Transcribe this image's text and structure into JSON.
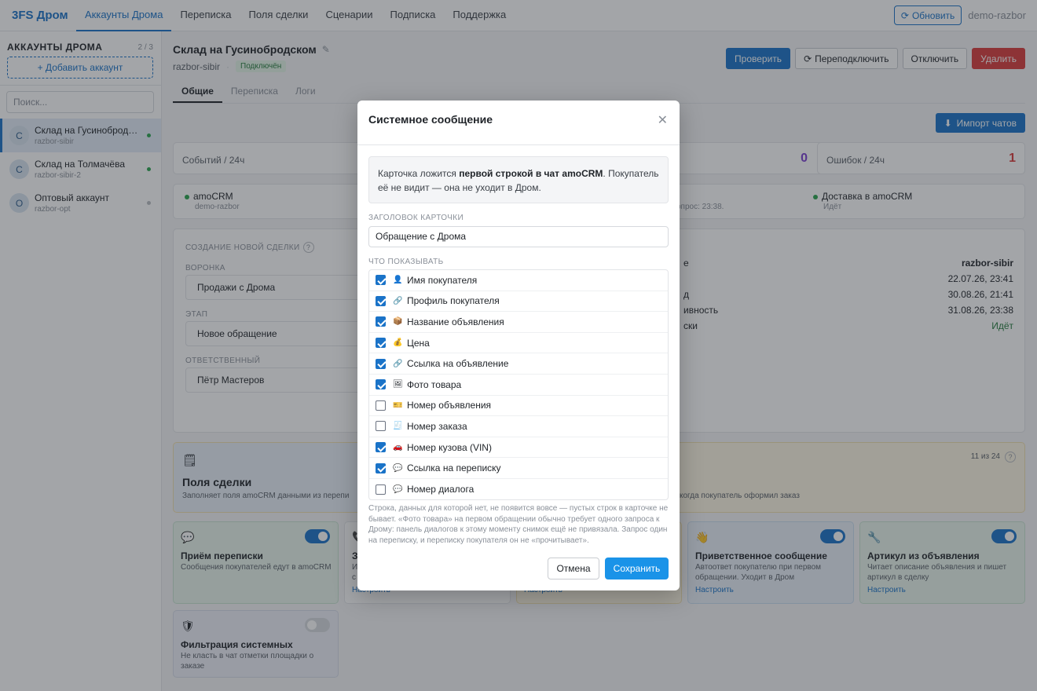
{
  "topbar": {
    "brand": "3FS Дром",
    "nav": [
      "Аккаунты Дрома",
      "Переписка",
      "Поля сделки",
      "Сценарии",
      "Подписка",
      "Поддержка"
    ],
    "refresh_label": "Обновить",
    "user": "demo-razbor"
  },
  "sidebar": {
    "title": "АККАУНТЫ ДРОМА",
    "count": "2 / 3",
    "add_label": "+ Добавить аккаунт",
    "search_placeholder": "Поиск...",
    "accounts": [
      {
        "letter": "С",
        "name": "Склад на Гусинобродском",
        "login": "razbor-sibir",
        "status": "on"
      },
      {
        "letter": "С",
        "name": "Склад на Толмачёва",
        "login": "razbor-sibir-2",
        "status": "on"
      },
      {
        "letter": "О",
        "name": "Оптовый аккаунт",
        "login": "razbor-opt",
        "status": "off"
      }
    ]
  },
  "main": {
    "title": "Склад на Гусинобродском",
    "login": "razbor-sibir",
    "status_badge": "Подключён",
    "actions": {
      "check": "Проверить",
      "reconnect": "Переподключить",
      "disconnect": "Отключить",
      "delete": "Удалить"
    },
    "tabs": [
      "Общие",
      "Переписка",
      "Логи"
    ],
    "import_label": "Импорт чатов",
    "stats": {
      "events_label": "Событий / 24ч",
      "middle_value": "0",
      "errors_label": "Ошибок / 24ч",
      "errors_value": "1"
    },
    "integrations": {
      "amocrm_name": "amoCRM",
      "amocrm_sub": "demo-razbor",
      "middle_sub": "опрос: 23:38.",
      "delivery_name": "Доставка в amoCRM",
      "delivery_sub": "Идёт"
    },
    "deal": {
      "label": "СОЗДАНИЕ НОВОЙ СДЕЛКИ",
      "pipeline_label": "ВОРОНКА",
      "pipeline": "Продажи с Дрома",
      "stage_label": "ЭТАП",
      "stage": "Новое обращение",
      "owner_label": "ОТВЕТСТВЕННЫЙ",
      "owner": "Пётр Мастеров"
    },
    "info_rows": [
      {
        "key": "е",
        "value": "razbor-sibir"
      },
      {
        "key": "",
        "value": "22.07.26, 23:41"
      },
      {
        "key": "д",
        "value": "30.08.26, 21:41"
      },
      {
        "key": "ивность",
        "value": "31.08.26, 23:38"
      },
      {
        "key": "ски",
        "value": "Идёт"
      }
    ],
    "fields_card": {
      "title": "Поля сделки",
      "desc": "Заполняет поля amoCRM данными из перепи",
      "right_desc": "когда покупатель оформил заказ",
      "counter": "11 из 24"
    },
    "features": [
      {
        "title": "Приём переписки",
        "desc": "Сообщения покупателей едут в amoCRM",
        "setup": "",
        "enabled": true
      },
      {
        "title": "З",
        "desc": "И\nс",
        "setup": "Настроить",
        "enabled": true
      },
      {
        "title": "",
        "desc": "",
        "setup": "Настроить",
        "enabled": true
      },
      {
        "title": "Приветственное сообщение",
        "desc": "Автоответ покупателю при первом обращении. Уходит в Дром",
        "setup": "Настроить",
        "enabled": true
      },
      {
        "title": "Артикул из объявления",
        "desc": "Читает описание объявления и пишет артикул в сделку",
        "setup": "Настроить",
        "enabled": true
      },
      {
        "title": "Фильтрация системных",
        "desc": "Не класть в чат отметки площадки о заказе",
        "setup": "",
        "enabled": false
      }
    ]
  },
  "modal": {
    "title": "Системное сообщение",
    "info_pre": "Карточка ложится ",
    "info_bold": "первой строкой в чат amoCRM",
    "info_post": ". Покупатель её не видит — она не уходит в Дром.",
    "header_label": "ЗАГОЛОВОК КАРТОЧКИ",
    "header_value": "Обращение с Дрома",
    "show_label": "ЧТО ПОКАЗЫВАТЬ",
    "items": [
      {
        "icon": "👤",
        "label": "Имя покупателя",
        "checked": true
      },
      {
        "icon": "🔗",
        "label": "Профиль покупателя",
        "checked": true
      },
      {
        "icon": "📦",
        "label": "Название объявления",
        "checked": true
      },
      {
        "icon": "💰",
        "label": "Цена",
        "checked": true
      },
      {
        "icon": "🔗",
        "label": "Ссылка на объявление",
        "checked": true
      },
      {
        "icon": "🖼",
        "label": "Фото товара",
        "checked": true
      },
      {
        "icon": "🎫",
        "label": "Номер объявления",
        "checked": false
      },
      {
        "icon": "🧾",
        "label": "Номер заказа",
        "checked": false
      },
      {
        "icon": "🚗",
        "label": "Номер кузова (VIN)",
        "checked": true
      },
      {
        "icon": "💬",
        "label": "Ссылка на переписку",
        "checked": true
      },
      {
        "icon": "💬",
        "label": "Номер диалога",
        "checked": false
      }
    ],
    "hint": "Строка, данных для которой нет, не появится вовсе — пустых строк в карточке не бывает. «Фото товара» на первом обращении обычно требует одного запроса к Дрому: панель диалогов к этому моменту снимок ещё не привязала. Запрос один на переписку, и переписку покупателя он не «прочитывает».",
    "cancel": "Отмена",
    "save": "Сохранить"
  },
  "colors": {
    "accent": "#1a73c8",
    "danger": "#d93b3b",
    "success": "#2aa44f",
    "purple": "#7b3fd1"
  }
}
